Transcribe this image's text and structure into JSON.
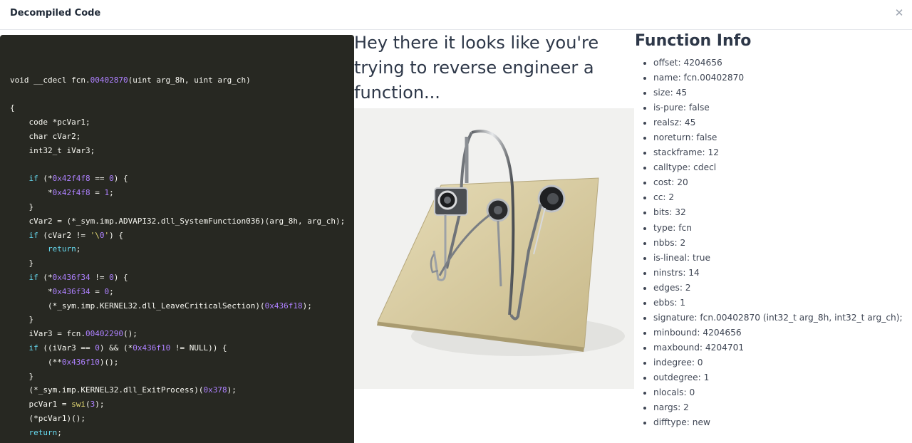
{
  "modal": {
    "title": "Decompiled Code",
    "close_icon": "close-icon"
  },
  "code_lines": [
    "",
    "void __cdecl fcn.00402870(uint arg_8h, uint arg_ch)",
    "",
    "{",
    "    code *pcVar1;",
    "    char cVar2;",
    "    int32_t iVar3;",
    "",
    "    if (*0x42f4f8 == 0) {",
    "        *0x42f4f8 = 1;",
    "    }",
    "    cVar2 = (*_sym.imp.ADVAPI32.dll_SystemFunction036)(arg_8h, arg_ch);",
    "    if (cVar2 != '\\0') {",
    "        return;",
    "    }",
    "    if (*0x436f34 != 0) {",
    "        *0x436f34 = 0;",
    "        (*_sym.imp.KERNEL32.dll_LeaveCriticalSection)(0x436f18);",
    "    }",
    "    iVar3 = fcn.00402290();",
    "    if ((iVar3 == 0) && (*0x436f10 != NULL)) {",
    "        (**0x436f10)();",
    "    }",
    "    (*_sym.imp.KERNEL32.dll_ExitProcess)(0x378);",
    "    pcVar1 = swi(3);",
    "    (*pcVar1)();",
    "    return;",
    "}"
  ],
  "hero": {
    "text": "Hey there it looks like you're trying to reverse engineer a function...",
    "image_icon": "paperclip-sculpture-image"
  },
  "function_info": {
    "title": "Function Info",
    "items": [
      "offset: 4204656",
      "name: fcn.00402870",
      "size: 45",
      "is-pure: false",
      "realsz: 45",
      "noreturn: false",
      "stackframe: 12",
      "calltype: cdecl",
      "cost: 20",
      "cc: 2",
      "bits: 32",
      "type: fcn",
      "nbbs: 2",
      "is-lineal: true",
      "ninstrs: 14",
      "edges: 2",
      "ebbs: 1",
      "signature: fcn.00402870 (int32_t arg_8h, int32_t arg_ch);",
      "minbound: 4204656",
      "maxbound: 4204701",
      "indegree: 0",
      "outdegree: 1",
      "nlocals: 0",
      "nargs: 2",
      "difftype: new"
    ]
  },
  "colors": {
    "code_bg": "#272822",
    "code_text": "#f8f8f2",
    "keyword": "#66d9ef",
    "number": "#ae81ff",
    "string": "#e6db74"
  }
}
